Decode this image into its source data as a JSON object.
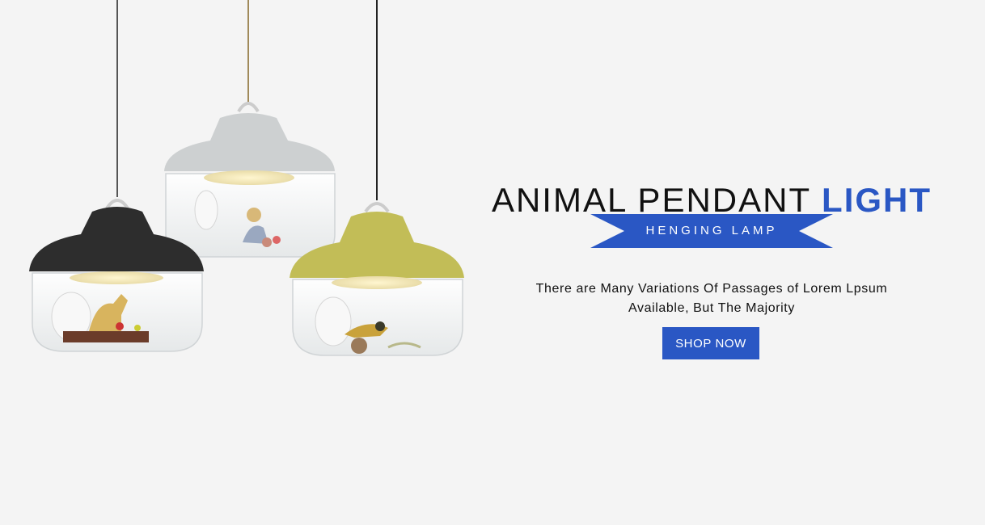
{
  "hero": {
    "title_main": "ANIMAL PENDANT",
    "title_accent": "LIGHT",
    "subtitle": "HENGING LAMP",
    "description": "There are Many Variations Of Passages of Lorem Lpsum Available, But The Majority",
    "cta_label": "SHOP NOW"
  },
  "image": {
    "subject": "three glass pendant lamps with black, grey and mustard shades containing animal figurines"
  },
  "colors": {
    "accent": "#2a57c4",
    "background": "#f4f4f4",
    "text": "#111111"
  }
}
